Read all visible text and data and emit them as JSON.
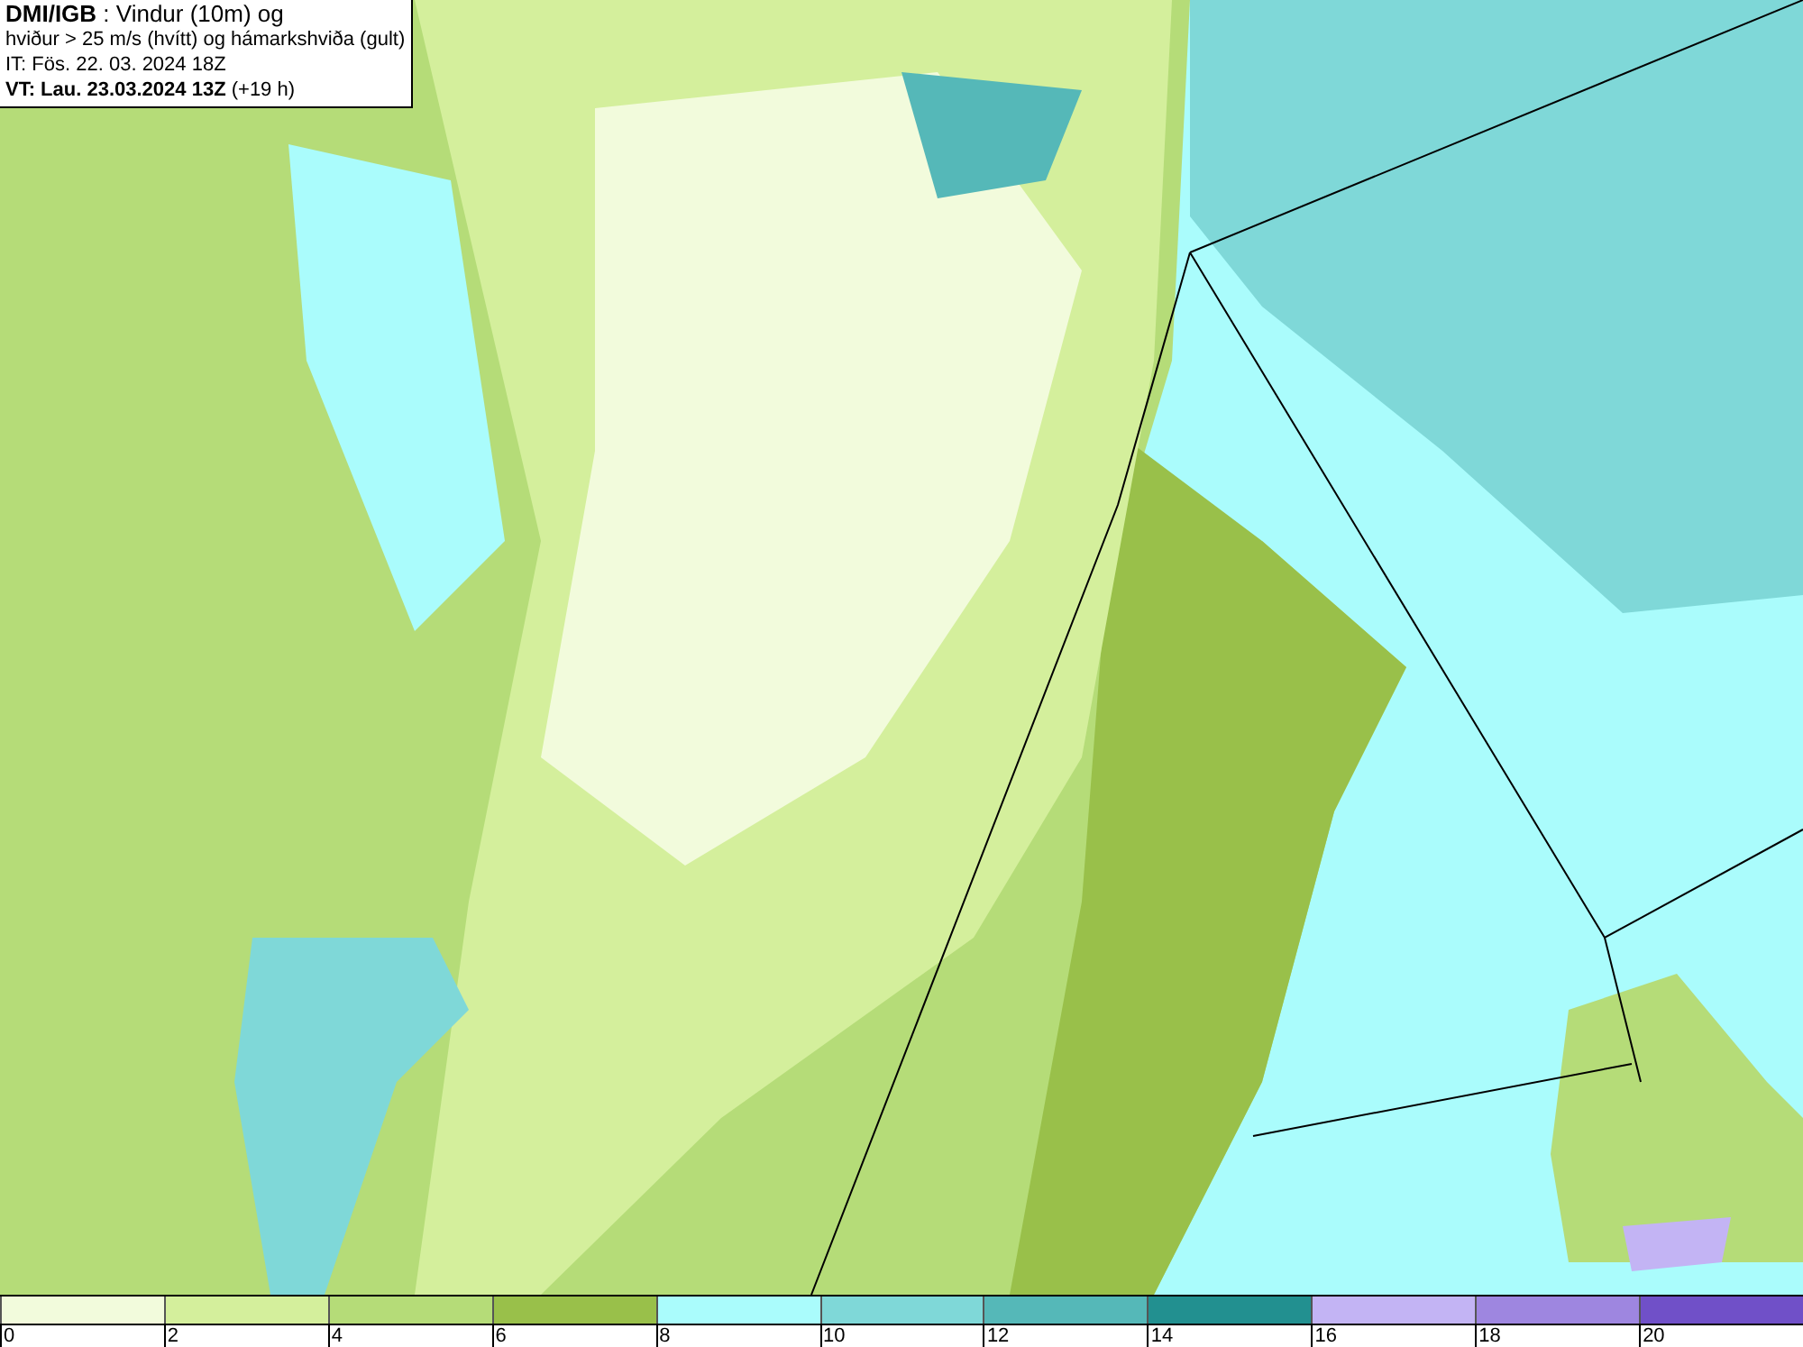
{
  "info_box": {
    "lines": [
      "**DMI/IGB** : Vindur (10m) og",
      "hviður > 25 m/s (hvítt) og hámarkshviða (gult)",
      "IT: Fös. 22. 03. 2024 18Z",
      "**VT: Lau. 23.03.2024 13Z** (+19 h)"
    ]
  },
  "legend": [
    {
      "label": "0",
      "color": "#f2fbdc"
    },
    {
      "label": "2",
      "color": "#d4ef9c"
    },
    {
      "label": "4",
      "color": "#b5dc78"
    },
    {
      "label": "6",
      "color": "#99c04a"
    },
    {
      "label": "8",
      "color": "#aafcfc"
    },
    {
      "label": "10",
      "color": "#7fd8d8"
    },
    {
      "label": "12",
      "color": "#55b8b8"
    },
    {
      "label": "14",
      "color": "#229090"
    },
    {
      "label": "16",
      "color": "#c3b4f4"
    },
    {
      "label": "18",
      "color": "#9e86e0"
    },
    {
      "label": "20",
      "color": "#7050c8"
    }
  ]
}
